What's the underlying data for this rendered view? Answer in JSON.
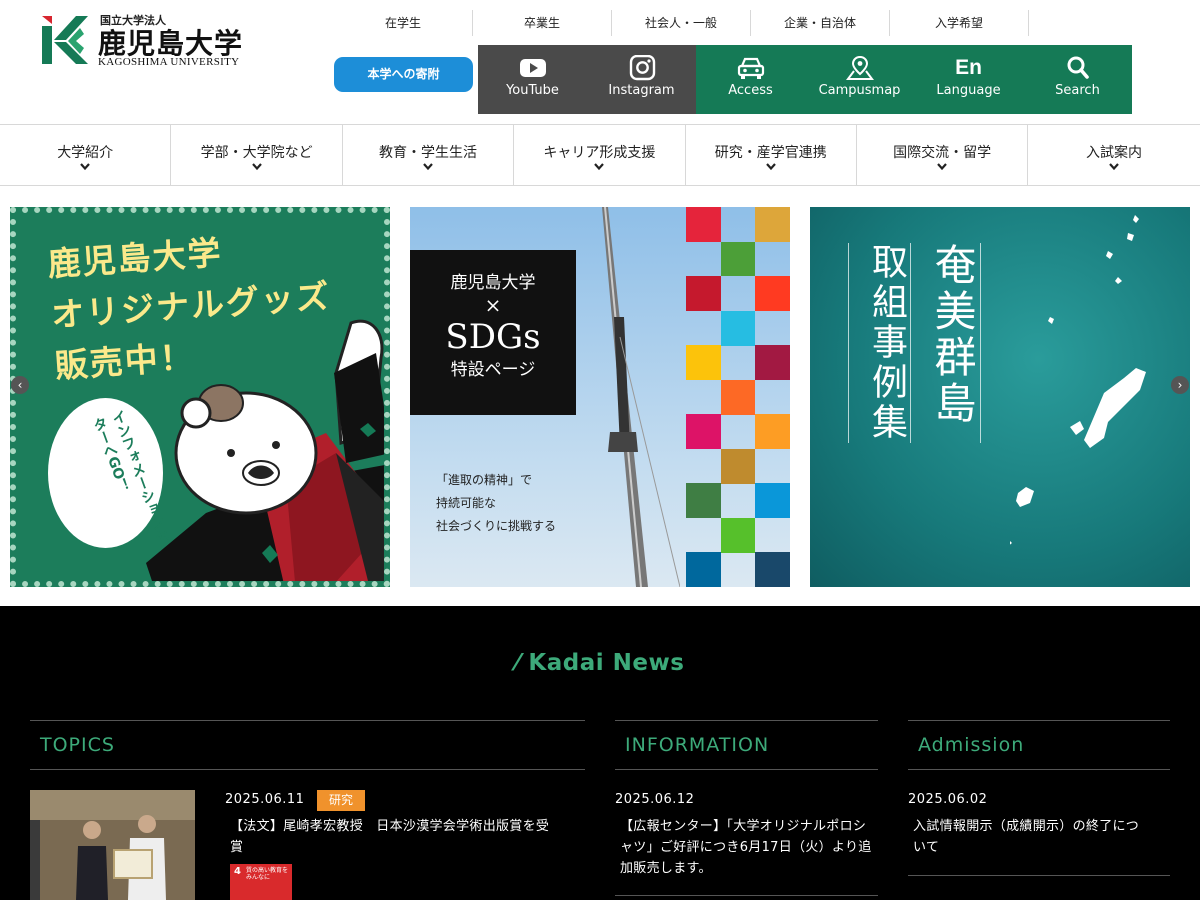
{
  "header": {
    "logo_small": "国立大学法人",
    "logo_big": "鹿児島大学",
    "logo_en": "KAGOSHIMA UNIVERSITY",
    "utility_links": [
      "在学生",
      "卒業生",
      "社会人・一般",
      "企業・自治体",
      "入学希望"
    ],
    "donate_label": "本学への寄附",
    "quick_links": [
      {
        "label": "YouTube",
        "icon": "youtube-icon"
      },
      {
        "label": "Instagram",
        "icon": "instagram-icon"
      },
      {
        "label": "Access",
        "icon": "car-icon"
      },
      {
        "label": "Campusmap",
        "icon": "map-pin-icon"
      },
      {
        "label": "Language",
        "icon": "language-icon",
        "glyph": "En"
      },
      {
        "label": "Search",
        "icon": "search-icon"
      }
    ],
    "colors": {
      "brand_green": "#157a56",
      "dark": "#4a4a4a",
      "donate_blue": "#1d8ed8"
    }
  },
  "gnav": [
    "大学紹介",
    "学部・大学院など",
    "教育・学生生活",
    "キャリア形成支援",
    "研究・産学官連携",
    "国際交流・留学",
    "入試案内"
  ],
  "banners": {
    "goods": {
      "headline_lines": [
        "鹿児島大学",
        "オリジナルグッズ",
        "販売中！"
      ],
      "bubble": "インフォメーションセンターへGO！"
    },
    "sdgs": {
      "box_lines": [
        "鹿児島大学",
        "×",
        "SDGs",
        "特設ページ"
      ],
      "caption_lines": [
        "「進取の精神」で",
        "持続可能な",
        "社会づくりに挑戦する"
      ]
    },
    "amami": {
      "col1": "取組事例集",
      "col2": "奄美群島"
    },
    "prev_arrow": "‹",
    "next_arrow": "›"
  },
  "news": {
    "title": "⁄ Kadai News",
    "topics": {
      "heading": "TOPICS",
      "date": "2025.06.11",
      "tag": "研究",
      "text_lines": [
        "【法文】尾崎孝宏教授　日本沙漠学会学術出版賞を受",
        "賞"
      ],
      "sdg_num": "4",
      "sdg_text": "質の高い教育をみんなに"
    },
    "information": {
      "heading": "INFORMATION",
      "date": "2025.06.12",
      "text_lines": [
        "【広報センター】「大学オリジナルポロシ",
        "ャツ」ご好評につき6月17日（火）より追",
        "加販売します。"
      ]
    },
    "admission": {
      "heading": "Admission",
      "date": "2025.06.02",
      "text_lines": [
        "入試情報開示（成績開示）の終了につ",
        "いて"
      ]
    }
  }
}
